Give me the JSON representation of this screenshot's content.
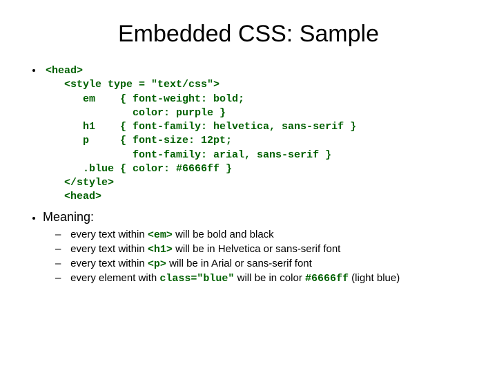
{
  "title": "Embedded CSS: Sample",
  "code": "<head>\n   <style type = \"text/css\">\n      em    { font-weight: bold;\n              color: purple }\n      h1    { font-family: helvetica, sans-serif }\n      p     { font-size: 12pt;\n              font-family: arial, sans-serif }\n      .blue { color: #6666ff }\n   </style>\n   <head>",
  "meaning_label": "Meaning:",
  "items": [
    {
      "pre": "every text within ",
      "code": "<em>",
      "post": " will be bold and black"
    },
    {
      "pre": "every text within ",
      "code": "<h1>",
      "post": " will be in Helvetica or sans-serif font"
    },
    {
      "pre": "every text within ",
      "code": "<p>",
      "post": " will be in Arial or sans-serif font"
    },
    {
      "pre": "every element with ",
      "code": "class=\"blue\"",
      "post": " will be in color ",
      "code2": "#6666ff",
      "post2": " (light blue)"
    }
  ]
}
